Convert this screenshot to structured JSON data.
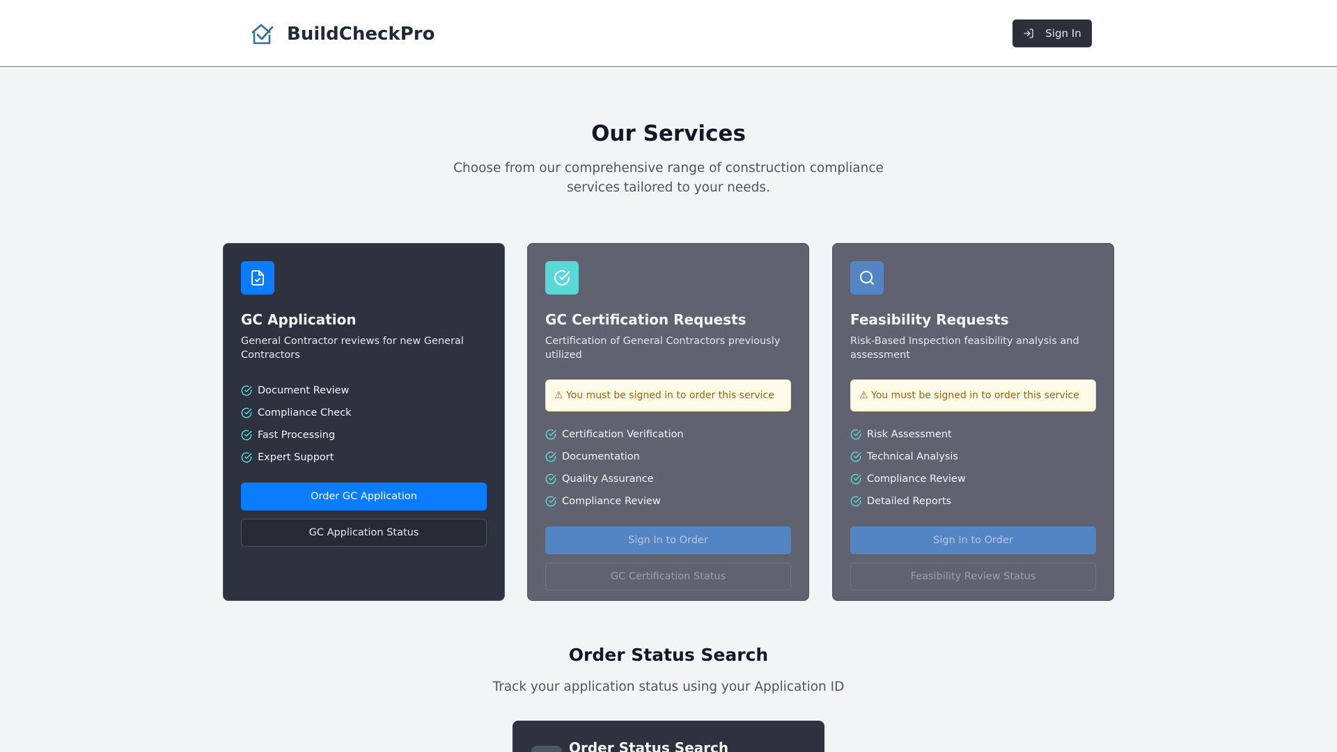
{
  "header": {
    "brand_name": "BuildCheckPro",
    "signin_label": "Sign In"
  },
  "hero": {
    "title": "Our Services",
    "subtitle": "Choose from our comprehensive range of construction compliance services tailored to your needs."
  },
  "warning_text": "⚠ You must be signed in to order this service",
  "cards": [
    {
      "title": "GC Application",
      "description": "General Contractor reviews for new General Contractors",
      "features": [
        "Document Review",
        "Compliance Check",
        "Fast Processing",
        "Expert Support"
      ],
      "primary_label": "Order GC Application",
      "secondary_label": "GC Application Status",
      "icon": "file-check-icon"
    },
    {
      "title": "GC Certification Requests",
      "description": "Certification of General Contractors previously utilized",
      "features": [
        "Certification Verification",
        "Documentation",
        "Quality Assurance",
        "Compliance Review"
      ],
      "primary_label": "Sign In to Order",
      "secondary_label": "GC Certification Status",
      "icon": "check-circle-icon"
    },
    {
      "title": "Feasibility Requests",
      "description": "Risk-Based Inspection feasibility analysis and assessment",
      "features": [
        "Risk Assessment",
        "Technical Analysis",
        "Compliance Review",
        "Detailed Reports"
      ],
      "primary_label": "Sign In to Order",
      "secondary_label": "Feasibility Review Status",
      "icon": "search-icon"
    }
  ],
  "order_status": {
    "title": "Order Status Search",
    "subtitle": "Track your application status using your Application ID",
    "card_title": "Order Status Search"
  },
  "colors": {
    "accent_blue": "#0a7cff",
    "teal": "#5ad8d8",
    "steel_blue": "#5384c4",
    "dark_card": "#2e323f",
    "gray_card": "#60636f",
    "warning_bg": "#fefbe8",
    "warning_text": "#a16207"
  }
}
